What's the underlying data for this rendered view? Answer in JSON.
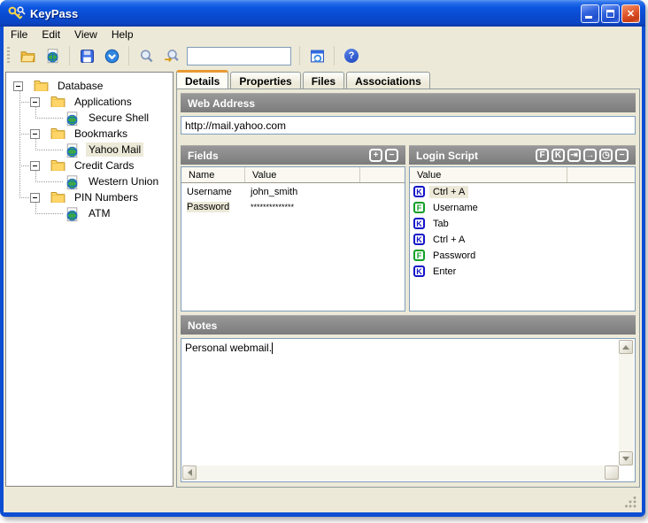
{
  "window": {
    "title": "KeyPass"
  },
  "menu": {
    "items": [
      "File",
      "Edit",
      "View",
      "Help"
    ]
  },
  "toolbar": {
    "search_value": "",
    "icons": [
      "open-folder",
      "open-url",
      "save",
      "commit",
      "search",
      "search-key",
      "autotype",
      "help"
    ]
  },
  "tree": {
    "items": [
      {
        "label": "Database",
        "type": "folder",
        "level": 0
      },
      {
        "label": "Applications",
        "type": "folder",
        "level": 1
      },
      {
        "label": "Secure Shell",
        "type": "entry",
        "level": 2
      },
      {
        "label": "Bookmarks",
        "type": "folder",
        "level": 1
      },
      {
        "label": "Yahoo Mail",
        "type": "entry",
        "level": 2,
        "selected": true
      },
      {
        "label": "Credit Cards",
        "type": "folder",
        "level": 1
      },
      {
        "label": "Western Union",
        "type": "entry",
        "level": 2
      },
      {
        "label": "PIN Numbers",
        "type": "folder",
        "level": 1
      },
      {
        "label": "ATM",
        "type": "entry",
        "level": 2
      }
    ]
  },
  "tabs": {
    "active": "Details",
    "items": [
      "Details",
      "Properties",
      "Files",
      "Associations"
    ]
  },
  "web_address": {
    "header": "Web Address",
    "value": "http://mail.yahoo.com"
  },
  "fields": {
    "header": "Fields",
    "buttons": [
      {
        "name": "add-field",
        "glyph": "+"
      },
      {
        "name": "remove-field",
        "glyph": "−"
      }
    ],
    "columns": [
      "Name",
      "Value"
    ],
    "rows": [
      {
        "name": "Username",
        "value": "john_smith",
        "selected": false
      },
      {
        "name": "Password",
        "value": "**************",
        "selected": true
      }
    ]
  },
  "login_script": {
    "header": "Login Script",
    "buttons": [
      {
        "name": "insert-field",
        "glyph": "F"
      },
      {
        "name": "insert-key",
        "glyph": "K"
      },
      {
        "name": "insert-tab",
        "glyph": "⇥"
      },
      {
        "name": "insert-enter",
        "glyph": "→"
      },
      {
        "name": "insert-delay",
        "glyph": "◷"
      },
      {
        "name": "remove-step",
        "glyph": "−"
      }
    ],
    "columns": [
      "Value"
    ],
    "items": [
      {
        "icon": "K",
        "label": "Ctrl + A",
        "selected": true
      },
      {
        "icon": "F",
        "label": "Username",
        "selected": false
      },
      {
        "icon": "K",
        "label": "Tab",
        "selected": false
      },
      {
        "icon": "K",
        "label": "Ctrl + A",
        "selected": false
      },
      {
        "icon": "F",
        "label": "Password",
        "selected": false
      },
      {
        "icon": "K",
        "label": "Enter",
        "selected": false
      }
    ]
  },
  "notes": {
    "header": "Notes",
    "value": "Personal webmail."
  },
  "colors": {
    "titlebar_blue": "#0d4ed2",
    "section_header_gray": "#7c7c7c",
    "active_tab_accent": "#e89a34",
    "k_icon_blue": "#1414c8",
    "f_icon_green": "#0f9f26",
    "close_button_red": "#d54a1e",
    "content_beige": "#ece9d8"
  }
}
